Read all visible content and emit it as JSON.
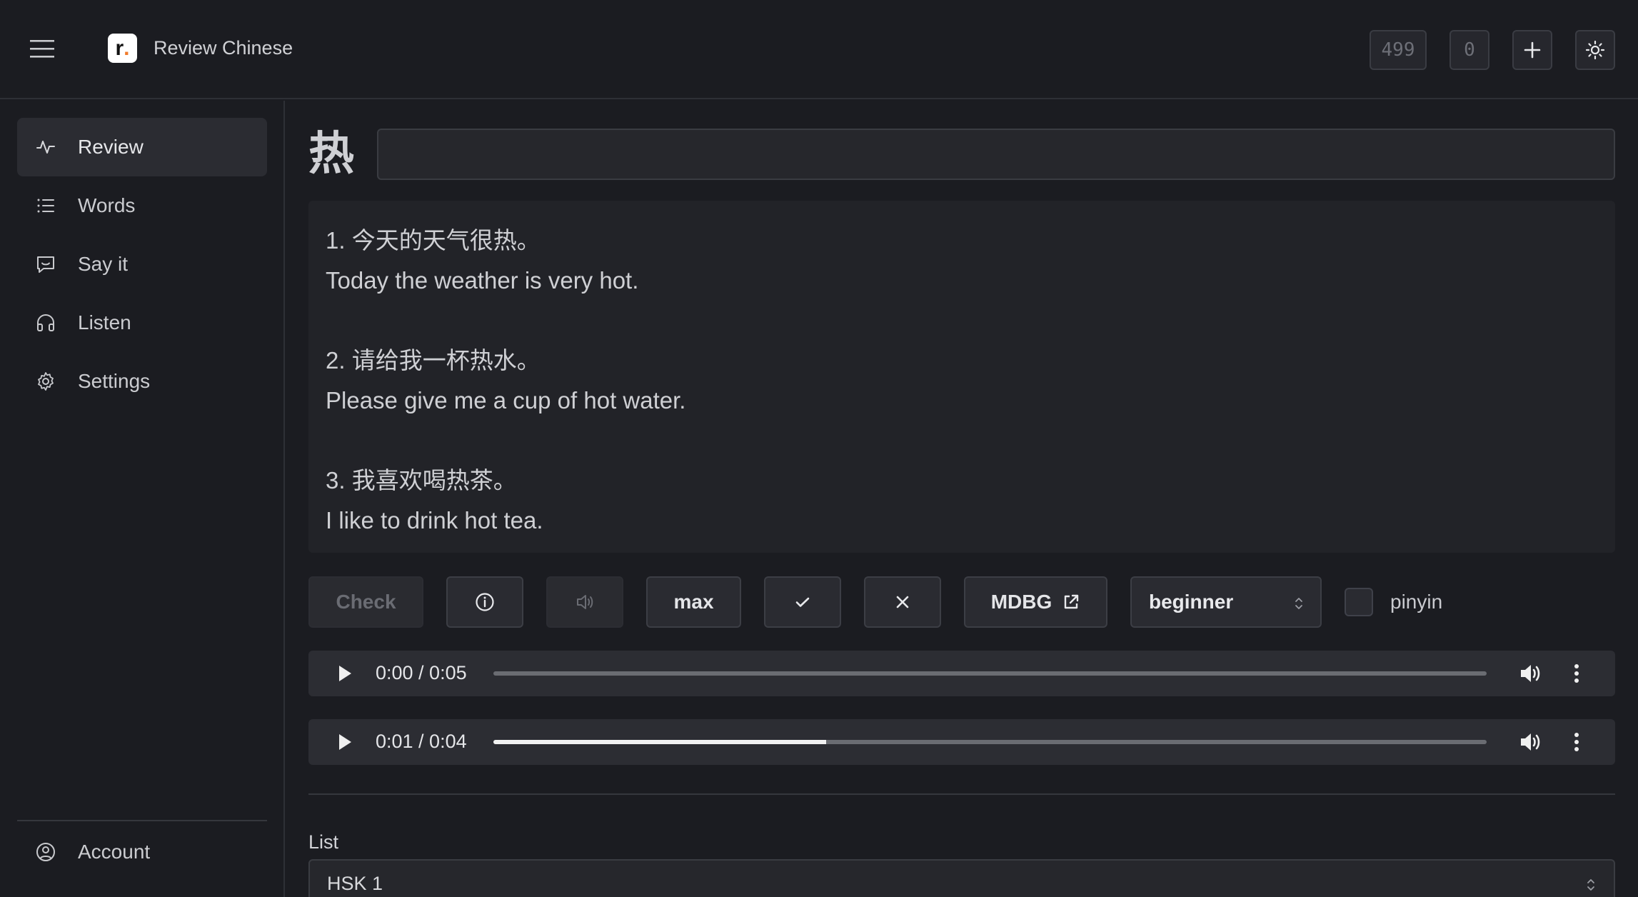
{
  "header": {
    "app_title": "Review Chinese",
    "logo_text": "r",
    "logo_dot": ".",
    "counter_1": "499",
    "counter_2": "0",
    "icons": [
      "menu-icon",
      "plus-icon",
      "sun-icon"
    ]
  },
  "sidebar": {
    "items": [
      {
        "label": "Review",
        "icon": "activity-icon",
        "active": true
      },
      {
        "label": "Words",
        "icon": "list-icon"
      },
      {
        "label": "Say it",
        "icon": "message-icon"
      },
      {
        "label": "Listen",
        "icon": "headphones-icon"
      },
      {
        "label": "Settings",
        "icon": "gear-icon"
      }
    ],
    "account_label": "Account"
  },
  "review": {
    "character": "热",
    "answer_value": "",
    "examples": [
      {
        "zh": "1. 今天的天气很热。",
        "en": "Today the weather is very hot."
      },
      {
        "zh": "2. 请给我一杯热水。",
        "en": "Please give me a cup of hot water."
      },
      {
        "zh": "3. 我喜欢喝热茶。",
        "en": "I like to drink hot tea."
      }
    ]
  },
  "toolbar": {
    "check_label": "Check",
    "max_label": "max",
    "mdbg_label": "MDBG",
    "level_value": "beginner",
    "pinyin_label": "pinyin"
  },
  "audio": [
    {
      "time": "0:00 / 0:05",
      "progress": 0.0
    },
    {
      "time": "0:01 / 0:04",
      "progress": 0.335
    }
  ],
  "list": {
    "label": "List",
    "value": "HSK 1"
  },
  "colors": {
    "background": "#1b1c21",
    "panel": "#222328",
    "logo_accent": "#f07a2a"
  }
}
